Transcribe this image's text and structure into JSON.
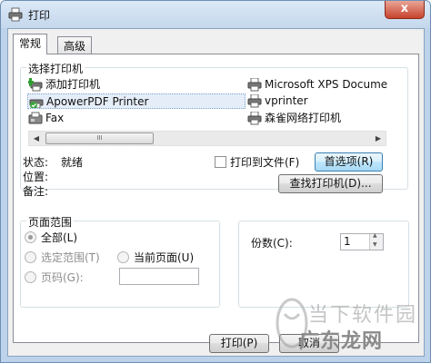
{
  "window": {
    "title": "打印",
    "close_glyph": "x"
  },
  "tabs": [
    {
      "label": "常规"
    },
    {
      "label": "高级"
    }
  ],
  "select_printer": {
    "label": "选择打印机",
    "printers": [
      {
        "name": "添加打印机",
        "icon": "add-printer-icon"
      },
      {
        "name": "ApowerPDF Printer",
        "icon": "default-printer-icon",
        "selected": true
      },
      {
        "name": "Fax",
        "icon": "fax-icon"
      },
      {
        "name": "Microsoft XPS Docume",
        "icon": "printer-icon"
      },
      {
        "name": "vprinter",
        "icon": "printer-icon"
      },
      {
        "name": "森雀网络打印机",
        "icon": "printer-icon"
      }
    ],
    "scroll_left": "◀",
    "scroll_right": "▶",
    "scroll_grip": "III"
  },
  "status": {
    "status_label": "状态:",
    "status_value": "就绪",
    "location_label": "位置:",
    "comment_label": "备注:"
  },
  "print_to_file": {
    "label": "打印到文件(F)",
    "checked": false
  },
  "buttons": {
    "preferences": "首选项(R)",
    "find_printer": "查找打印机(D)...",
    "print": "打印(P)",
    "cancel": "取消"
  },
  "page_range": {
    "label": "页面范围",
    "all": "全部(L)",
    "selection": "选定范围(T)",
    "current_page": "当前页面(U)",
    "pages": "页码(G):",
    "selected_option": "all"
  },
  "copies": {
    "label": "份数(C):",
    "value": "1",
    "up": "▲",
    "down": "▼"
  },
  "watermark": {
    "line1": "当下软件园",
    "line2": "广东龙网"
  },
  "colors": {
    "title_bar": "#c4d7ec",
    "close_button": "#c7432c",
    "focus_button": "#3c7fb1"
  }
}
